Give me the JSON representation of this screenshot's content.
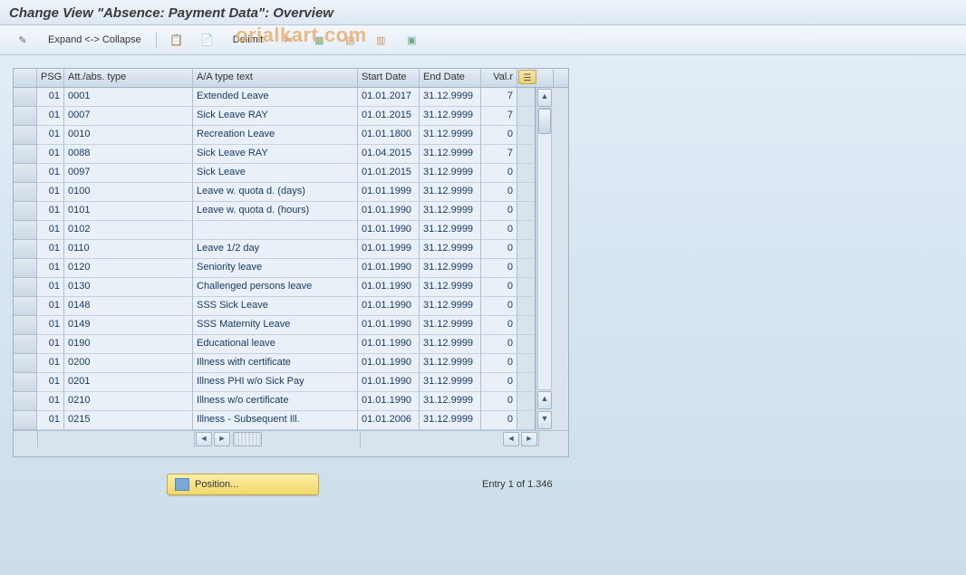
{
  "title": "Change View \"Absence: Payment Data\": Overview",
  "watermark": "orialkart.com",
  "toolbar": {
    "expand_collapse": "Expand <-> Collapse",
    "delimit": "Delimit"
  },
  "grid": {
    "headers": {
      "sel": "",
      "psg": "PSG",
      "att": "Att./abs. type",
      "txt": "A/A type text",
      "start": "Start Date",
      "end": "End Date",
      "val": "Val.r"
    },
    "rows": [
      {
        "psg": "01",
        "att": "0001",
        "txt": "Extended Leave",
        "start": "01.01.2017",
        "end": "31.12.9999",
        "val": "7"
      },
      {
        "psg": "01",
        "att": "0007",
        "txt": "Sick Leave RAY",
        "start": "01.01.2015",
        "end": "31.12.9999",
        "val": "7"
      },
      {
        "psg": "01",
        "att": "0010",
        "txt": "Recreation Leave",
        "start": "01.01.1800",
        "end": "31.12.9999",
        "val": "0"
      },
      {
        "psg": "01",
        "att": "0088",
        "txt": "Sick Leave RAY",
        "start": "01.04.2015",
        "end": "31.12.9999",
        "val": "7"
      },
      {
        "psg": "01",
        "att": "0097",
        "txt": "Sick Leave",
        "start": "01.01.2015",
        "end": "31.12.9999",
        "val": "0"
      },
      {
        "psg": "01",
        "att": "0100",
        "txt": "Leave w. quota d. (days)",
        "start": "01.01.1999",
        "end": "31.12.9999",
        "val": "0"
      },
      {
        "psg": "01",
        "att": "0101",
        "txt": "Leave w. quota d. (hours)",
        "start": "01.01.1990",
        "end": "31.12.9999",
        "val": "0"
      },
      {
        "psg": "01",
        "att": "0102",
        "txt": "",
        "start": "01.01.1990",
        "end": "31.12.9999",
        "val": "0"
      },
      {
        "psg": "01",
        "att": "0110",
        "txt": "Leave 1/2 day",
        "start": "01.01.1999",
        "end": "31.12.9999",
        "val": "0"
      },
      {
        "psg": "01",
        "att": "0120",
        "txt": "Seniority leave",
        "start": "01.01.1990",
        "end": "31.12.9999",
        "val": "0"
      },
      {
        "psg": "01",
        "att": "0130",
        "txt": "Challenged persons leave",
        "start": "01.01.1990",
        "end": "31.12.9999",
        "val": "0"
      },
      {
        "psg": "01",
        "att": "0148",
        "txt": "SSS Sick Leave",
        "start": "01.01.1990",
        "end": "31.12.9999",
        "val": "0"
      },
      {
        "psg": "01",
        "att": "0149",
        "txt": "SSS Maternity Leave",
        "start": "01.01.1990",
        "end": "31.12.9999",
        "val": "0"
      },
      {
        "psg": "01",
        "att": "0190",
        "txt": "Educational leave",
        "start": "01.01.1990",
        "end": "31.12.9999",
        "val": "0"
      },
      {
        "psg": "01",
        "att": "0200",
        "txt": "Illness with certificate",
        "start": "01.01.1990",
        "end": "31.12.9999",
        "val": "0"
      },
      {
        "psg": "01",
        "att": "0201",
        "txt": "Illness PHI w/o Sick Pay",
        "start": "01.01.1990",
        "end": "31.12.9999",
        "val": "0"
      },
      {
        "psg": "01",
        "att": "0210",
        "txt": "Illness w/o certificate",
        "start": "01.01.1990",
        "end": "31.12.9999",
        "val": "0"
      },
      {
        "psg": "01",
        "att": "0215",
        "txt": "Illness - Subsequent Ill.",
        "start": "01.01.2006",
        "end": "31.12.9999",
        "val": "0"
      }
    ]
  },
  "footer": {
    "position_label": "Position...",
    "entry_label": "Entry 1 of 1.346"
  }
}
